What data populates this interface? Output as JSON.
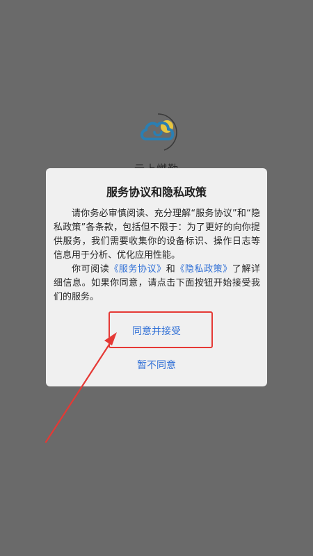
{
  "app": {
    "name": "云上燃勤"
  },
  "dialog": {
    "title": "服务协议和隐私政策",
    "paragraph1": "请你务必审慎阅读、充分理解“服务协议”和“隐私政策”各条款，包括但不限于：为了更好的向你提供服务，我们需要收集你的设备标识、操作日志等信息用于分析、优化应用性能。",
    "paragraph2_prefix": "你可阅读",
    "link_service": "《服务协议》",
    "paragraph2_and": "和",
    "link_privacy": "《隐私政策》",
    "paragraph2_suffix": "了解详细信息。如果你同意，请点击下面按钮开始接受我们的服务。",
    "accept_label": "同意并接受",
    "decline_label": "暂不同意"
  },
  "colors": {
    "overlay": "#6a6a6a",
    "dialog_bg": "#f0f0f0",
    "link": "#2f6fd6",
    "annotation": "#e53935"
  }
}
